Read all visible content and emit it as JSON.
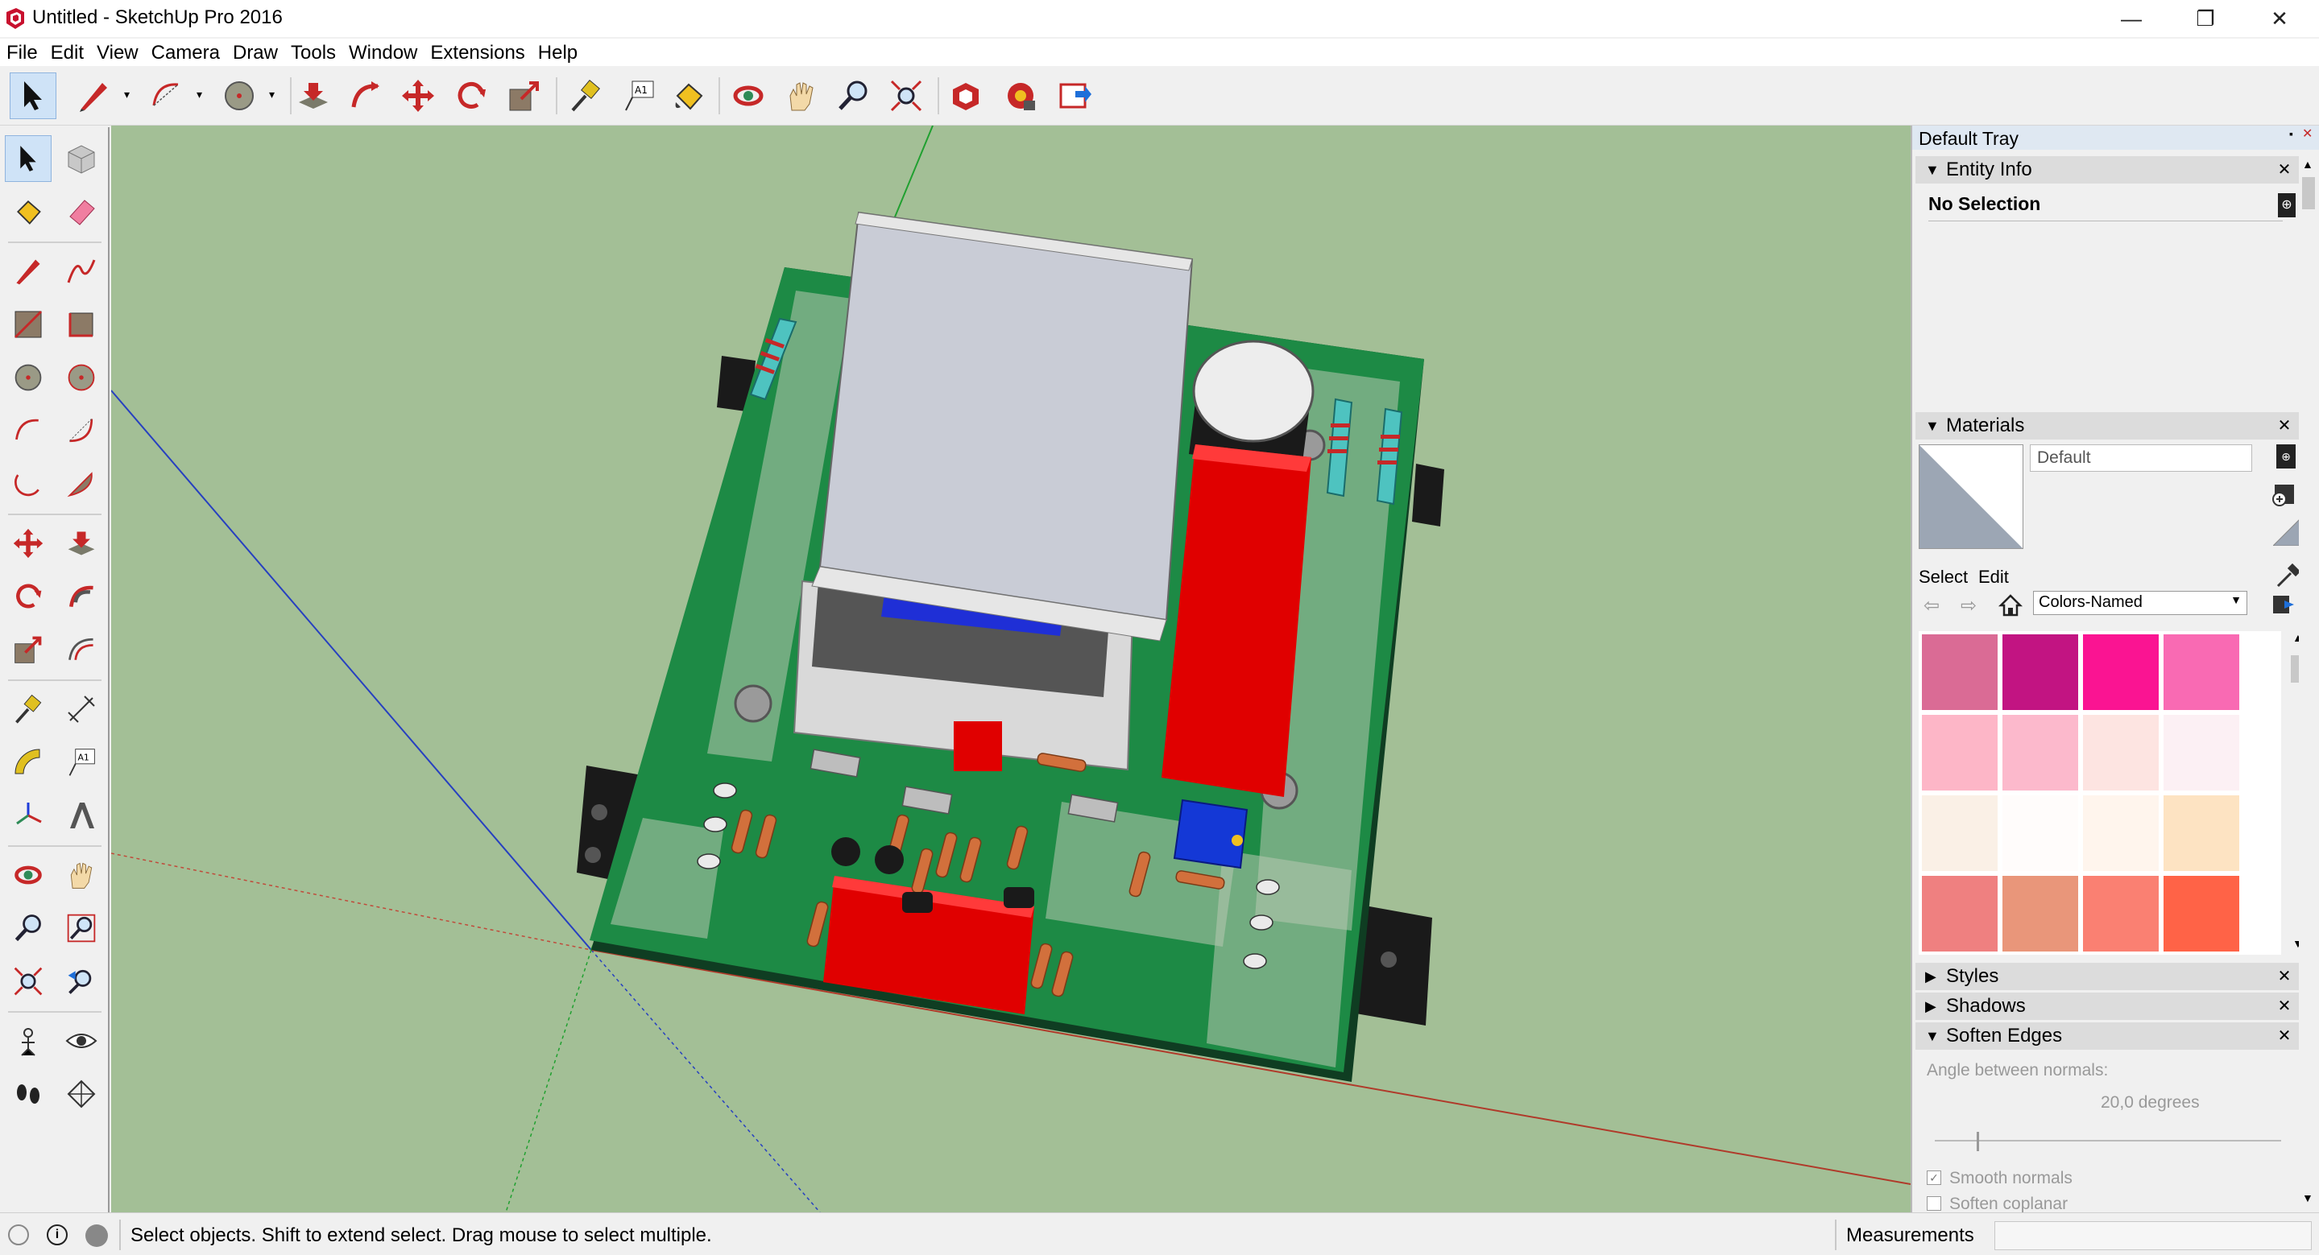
{
  "window": {
    "title": "Untitled - SketchUp Pro 2016",
    "minimize": "—",
    "restore": "❐",
    "close": "✕"
  },
  "menu": [
    "File",
    "Edit",
    "View",
    "Camera",
    "Draw",
    "Tools",
    "Window",
    "Extensions",
    "Help"
  ],
  "toolbar": {
    "icons": [
      "select-icon",
      "pencil-line-icon",
      "arc-icon",
      "circle-icon",
      "push-pull-icon",
      "follow-me-icon",
      "move-icon",
      "rotate-icon",
      "scale-icon",
      "tape-measure-icon",
      "text-icon",
      "paint-bucket-icon",
      "orbit-icon",
      "pan-icon",
      "zoom-icon",
      "zoom-extents-icon",
      "warehouse-icon",
      "extension-warehouse-icon",
      "send-to-layout-icon"
    ],
    "text_tool_label": "A1"
  },
  "left_toolbar": {
    "text_tool_label": "A1"
  },
  "tray": {
    "title": "Default Tray",
    "entity_info": {
      "title": "Entity Info",
      "selection": "No Selection"
    },
    "materials": {
      "title": "Materials",
      "current_material": "Default",
      "select_tab": "Select",
      "edit_tab": "Edit",
      "library": "Colors-Named",
      "swatches": [
        "#da6b95",
        "#c21482",
        "#fa1492",
        "#f96ab3",
        "#fdb6c7",
        "#fcb9cc",
        "#fde4e1",
        "#fcf0f4",
        "#faf0e6",
        "#fffcfb",
        "#fff5ed",
        "#fde3c2",
        "#ef8080",
        "#e9967a",
        "#fa8072",
        "#ff6347"
      ]
    },
    "styles": {
      "title": "Styles"
    },
    "shadows": {
      "title": "Shadows"
    },
    "soften_edges": {
      "title": "Soften Edges",
      "angle_label": "Angle between normals:",
      "angle_value": "20,0  degrees",
      "smooth_normals": "Smooth normals",
      "smooth_checked": true,
      "soften_coplanar": "Soften coplanar",
      "coplanar_checked": false
    }
  },
  "status": {
    "message": "Select objects. Shift to extend select. Drag mouse to select multiple.",
    "measurements_label": "Measurements",
    "measurements_value": ""
  }
}
